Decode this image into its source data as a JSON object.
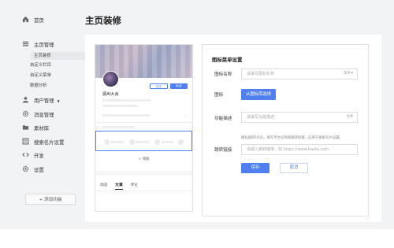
{
  "sidebar": {
    "home": "首页",
    "homepage_mgmt": "主页管理",
    "sub_items": [
      "主页装修",
      "自定义栏目",
      "自定义菜单",
      "数据分析"
    ],
    "user_mgmt": "用户管理",
    "message_mgmt": "消息管理",
    "library": "素材库",
    "card_settings": "搜索名片设置",
    "develop": "开发",
    "settings": "设置",
    "add_function": "+ 添加功能"
  },
  "page": {
    "title": "主页装修"
  },
  "preview": {
    "follow_label": "关注",
    "message_label": "私信",
    "name": "源AI大会",
    "add_label": "+ 添加",
    "tabs": [
      "动态",
      "文章",
      "评论"
    ]
  },
  "form": {
    "title": "图标菜单设置",
    "icon_name_label": "图标名称",
    "icon_name_placeholder": "请填写图标名称",
    "icon_name_counter": "0/4",
    "icon_label": "图标",
    "icon_button": "从图标库选择",
    "desc_label": "功能描述",
    "desc_placeholder": "请填写功能描述",
    "desc_counter": "0/4",
    "desc_hint": "图标跳转H5页，填写平台名称和跳转链接，应用于搜索名片设置。",
    "link_label": "跳转链接",
    "link_placeholder": "请输入跳转链接，如 https://www.baidu.com",
    "save_label": "保存",
    "cancel_label": "取消"
  },
  "colors": {
    "accent": "#4f7ff0",
    "background": "#f2f3f5"
  }
}
